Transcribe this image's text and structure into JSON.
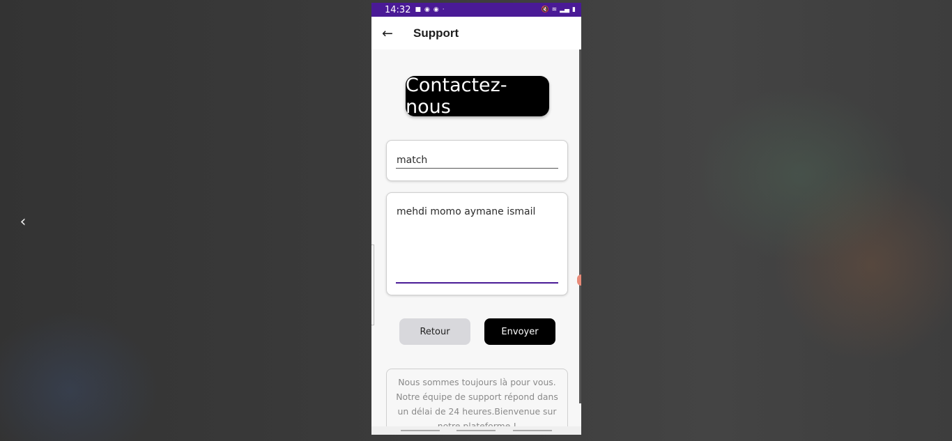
{
  "status_bar": {
    "time": "14:32",
    "left_icons": [
      "video-icon",
      "notification-icon",
      "notification-icon",
      "dot-icon"
    ],
    "right_icons": [
      "mute-icon",
      "wifi-icon",
      "signal-icon",
      "battery-icon"
    ]
  },
  "app_bar": {
    "title": "Support"
  },
  "page": {
    "heading": "Contactez-nous",
    "subject_value": "match",
    "message_value": "mehdi momo aymane ismail",
    "retour_label": "Retour",
    "envoyer_label": "Envoyer",
    "info_text": "Nous sommes toujours là pour vous. Notre équipe de support répond dans un délai de 24 heures.Bienvenue sur notre plateforme !",
    "info_emoji": "😘"
  },
  "colors": {
    "status_bar": "#4a1a96",
    "accent": "#4a1a96",
    "primary_button": "#000000",
    "secondary_button": "#d8d8dc"
  }
}
